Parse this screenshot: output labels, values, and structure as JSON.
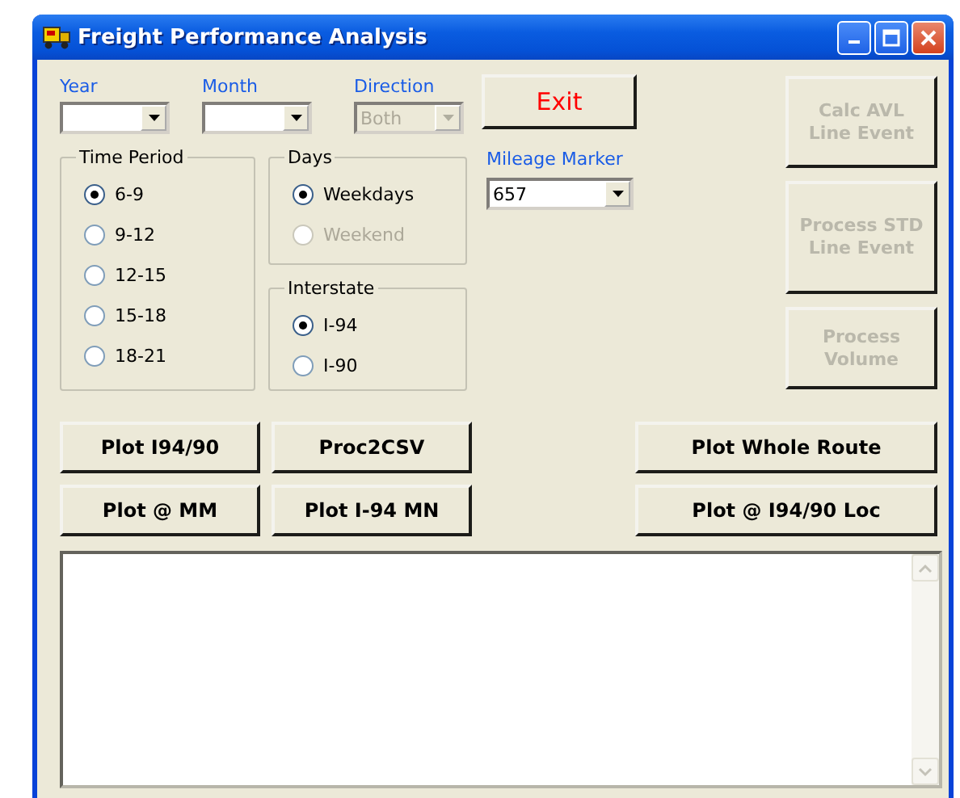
{
  "window": {
    "title": "Freight Performance Analysis"
  },
  "filters": [
    {
      "label": "Year",
      "disabled": false
    },
    {
      "label": "Month",
      "disabled": false
    },
    {
      "label": "Direction",
      "value": "Both",
      "disabled": true
    }
  ],
  "exit_button": {
    "label": "Exit"
  },
  "mileage_marker": {
    "label": "Mileage Marker",
    "value": "657"
  },
  "side_buttons": [
    {
      "lines": [
        "Calc AVL",
        "Line Event"
      ],
      "disabled": true
    },
    {
      "lines": [
        "Process STD",
        "Line Event"
      ],
      "disabled": true
    },
    {
      "lines": [
        "Process",
        "Volume"
      ],
      "disabled": true
    }
  ],
  "time_period": {
    "title": "Time Period",
    "options": [
      {
        "label": "6-9",
        "selected": true,
        "disabled": false
      },
      {
        "label": "9-12",
        "selected": false,
        "disabled": false
      },
      {
        "label": "12-15",
        "selected": false,
        "disabled": false
      },
      {
        "label": "15-18",
        "selected": false,
        "disabled": false
      },
      {
        "label": "18-21",
        "selected": false,
        "disabled": false
      }
    ]
  },
  "days": {
    "title": "Days",
    "options": [
      {
        "label": "Weekdays",
        "selected": true,
        "disabled": false
      },
      {
        "label": "Weekend",
        "selected": false,
        "disabled": true
      }
    ]
  },
  "interstate": {
    "title": "Interstate",
    "options": [
      {
        "label": "I-94",
        "selected": true,
        "disabled": false
      },
      {
        "label": "I-90",
        "selected": false,
        "disabled": false
      }
    ]
  },
  "button_rows": [
    [
      "Plot I94/90",
      "Proc2CSV",
      "Plot Whole Route"
    ],
    [
      "Plot @ MM",
      "Plot I-94 MN",
      "Plot @ I94/90 Loc"
    ]
  ]
}
